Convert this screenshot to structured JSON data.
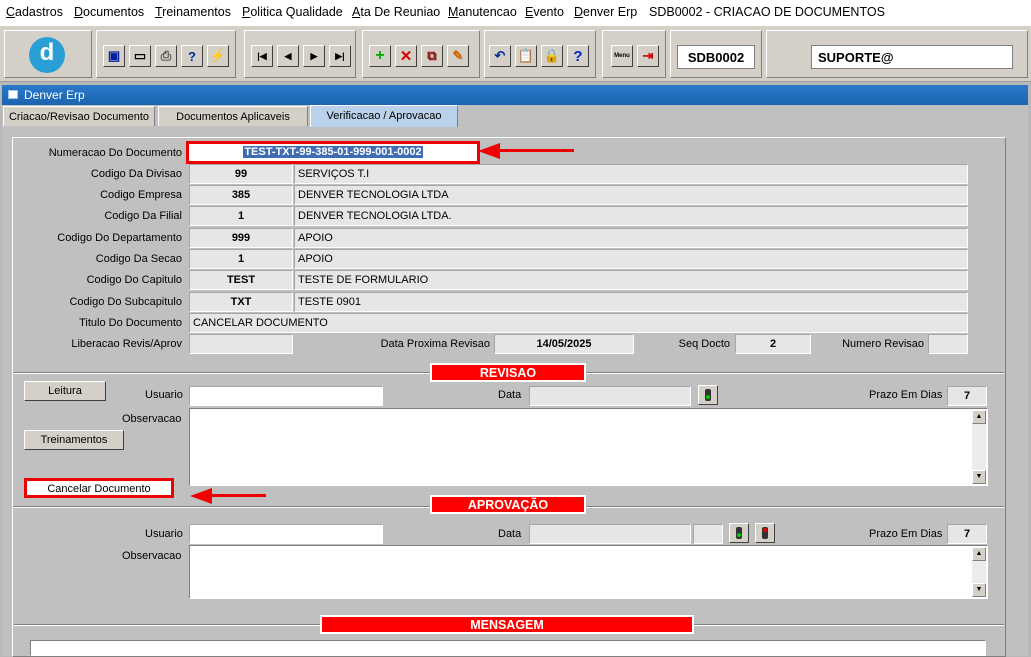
{
  "menu": [
    {
      "label": "Cadastros",
      "ul": "C",
      "rest": "adastros"
    },
    {
      "label": "Documentos",
      "ul": "D",
      "rest": "ocumentos"
    },
    {
      "label": "Treinamentos",
      "ul": "T",
      "rest": "reinamentos"
    },
    {
      "label": "Politica Qualidade",
      "ul": "P",
      "rest": "olitica Qualidade"
    },
    {
      "label": "Ata De Reuniao",
      "ul": "A",
      "rest": "ta De Reuniao"
    },
    {
      "label": "Manutencao",
      "ul": "M",
      "rest": "anutencao"
    },
    {
      "label": "Evento",
      "ul": "E",
      "rest": "vento"
    },
    {
      "label": "Denver Erp",
      "ul": "D",
      "rest": "enver Erp"
    },
    {
      "label": "SDB0002 - CRIACAO DE DOCUMENTOS",
      "ul": "",
      "rest": "SDB0002 - CRIACAO DE DOCUMENTOS"
    }
  ],
  "toolbar": {
    "program_code": "SDB0002",
    "user": "SUPORTE@",
    "logo_letter": "d",
    "icons": [
      "save-icon",
      "print-screen-icon",
      "print-icon",
      "query-icon",
      "execute-query-icon",
      "first-record-icon",
      "previous-record-icon",
      "next-record-icon",
      "last-record-icon",
      "insert-record-icon",
      "delete-record-icon",
      "duplicate-record-icon",
      "edit-record-icon",
      "undo-icon",
      "clipboard-icon",
      "lock-icon",
      "help-icon",
      "menu-icon",
      "exit-icon"
    ],
    "menu_icon_text": "Menu"
  },
  "window": {
    "title": "Denver Erp"
  },
  "tabs": [
    {
      "label": "Criacao/Revisao Documento",
      "active": false
    },
    {
      "label": "Documentos Aplicaveis",
      "active": false
    },
    {
      "label": "Verificacao / Aprovacao",
      "active": true
    }
  ],
  "form": {
    "numeracao_label": "Numeracao Do Documento",
    "numeracao_value": "TEST-TXT-99-385-01-999-001-0002",
    "rows": [
      {
        "label": "Codigo Da Divisao",
        "code": "99",
        "desc": "SERVIÇOS T.I"
      },
      {
        "label": "Codigo Empresa",
        "code": "385",
        "desc": "DENVER TECNOLOGIA LTDA"
      },
      {
        "label": "Codigo Da Filial",
        "code": "1",
        "desc": "DENVER TECNOLOGIA LTDA."
      },
      {
        "label": "Codigo Do Departamento",
        "code": "999",
        "desc": "APOIO"
      },
      {
        "label": "Codigo Da Secao",
        "code": "1",
        "desc": "APOIO"
      },
      {
        "label": "Codigo Do Capitulo",
        "code": "TEST",
        "desc": "TESTE DE FORMULARIO"
      },
      {
        "label": "Codigo Do Subcapitulo",
        "code": "TXT",
        "desc": "TESTE 0901"
      }
    ],
    "titulo_label": "Titulo Do Documento",
    "titulo_value": "CANCELAR DOCUMENTO",
    "liberacao_label": "Liberacao Revis/Aprov",
    "liberacao_value": "",
    "data_proxima_label": "Data Proxima Revisao",
    "data_proxima_value": "14/05/2025",
    "seq_label": "Seq Docto",
    "seq_value": "2",
    "num_rev_label": "Numero Revisao",
    "num_rev_value": ""
  },
  "revisao": {
    "header": "REVISAO",
    "leitura_button": "Leitura",
    "treinamentos_button": "Treinamentos",
    "cancelar_button": "Cancelar Documento",
    "usuario_label": "Usuario",
    "usuario_value": "",
    "data_label": "Data",
    "data_value": "",
    "prazo_label": "Prazo Em Dias",
    "prazo_value": "7",
    "observacao_label": "Observacao"
  },
  "aprovacao": {
    "header": "APROVAÇÃO",
    "usuario_label": "Usuario",
    "usuario_value": "",
    "data_label": "Data",
    "data_value": "",
    "prazo_label": "Prazo Em Dias",
    "prazo_value": "7",
    "observacao_label": "Observacao"
  },
  "mensagem": {
    "header": "MENSAGEM"
  },
  "colors": {
    "highlight": "#e00000",
    "section_header": "#ff0000",
    "title_bar": "#1b64b0",
    "active_tab": "#b9d1ea",
    "selection": "#3f6db3"
  }
}
